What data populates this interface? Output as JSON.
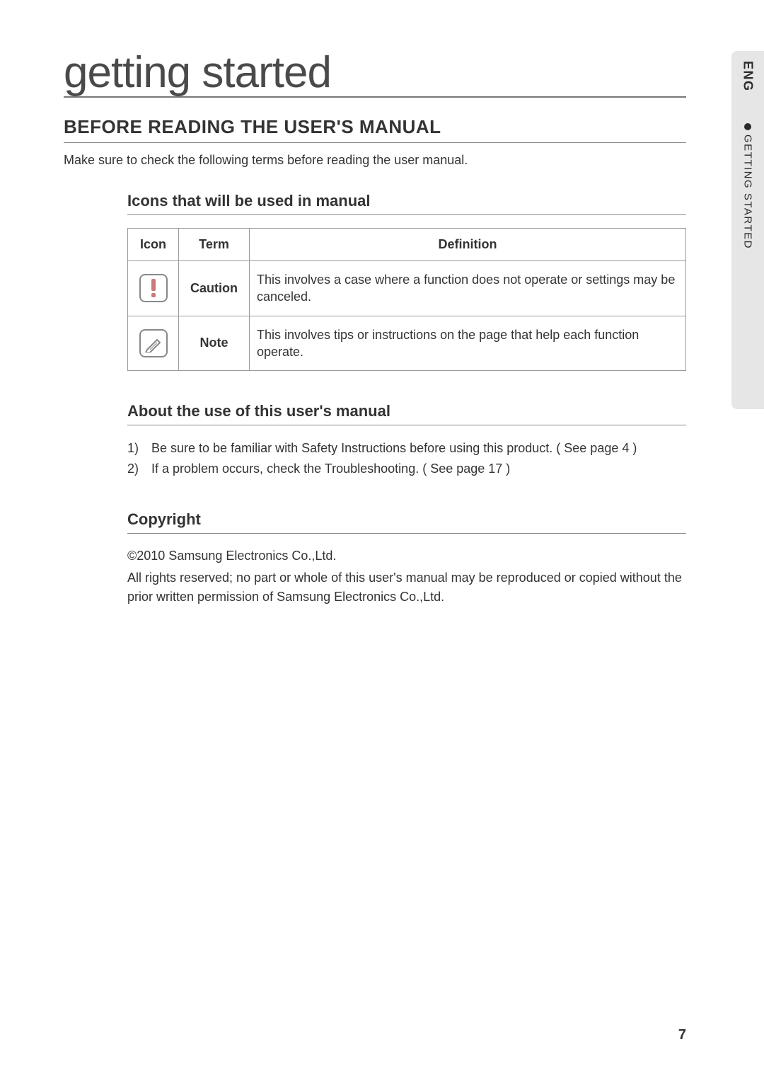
{
  "sideTab": {
    "lang": "ENG",
    "sectionLabel": "GETTING STARTED"
  },
  "title": "getting started",
  "section": "BEFORE READING THE USER'S MANUAL",
  "intro": "Make sure to check the following terms before reading the user manual.",
  "iconsTable": {
    "heading": "Icons that will be used in manual",
    "headers": {
      "icon": "Icon",
      "term": "Term",
      "definition": "Definition"
    },
    "rows": [
      {
        "iconName": "caution-icon",
        "term": "Caution",
        "definition": "This involves a case where a function does not operate or settings may be canceled."
      },
      {
        "iconName": "note-icon",
        "term": "Note",
        "definition": "This involves tips or instructions on the page that help each function operate."
      }
    ]
  },
  "about": {
    "heading": "About the use of this user's manual",
    "items": [
      {
        "num": "1)",
        "text": "Be sure to be familiar with Safety Instructions before using this product. ( See page 4 )"
      },
      {
        "num": "2)",
        "text": "If a problem occurs, check the Troubleshooting. ( See page 17 )"
      }
    ]
  },
  "copyright": {
    "heading": "Copyright",
    "line1": "©2010 Samsung Electronics Co.,Ltd.",
    "line2": "All rights reserved; no part or whole of this user's manual may be reproduced or copied without the prior written permission of Samsung Electronics Co.,Ltd."
  },
  "pageNumber": "7"
}
